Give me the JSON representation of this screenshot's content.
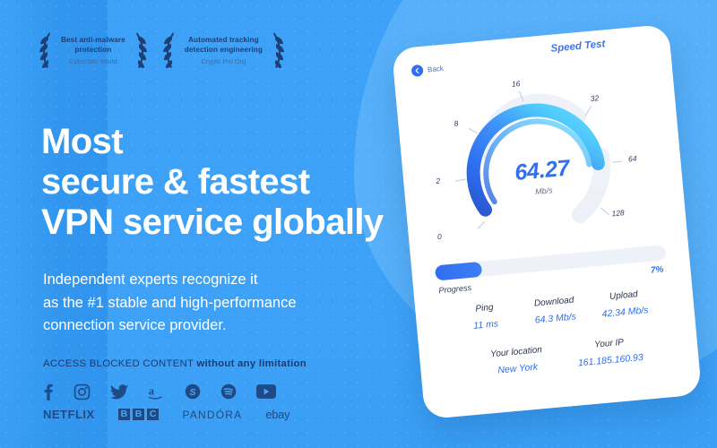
{
  "theme": {
    "bg": "#3da2f7",
    "accent": "#2f6ff0",
    "dark_text": "#1a3c72",
    "card_bg": "#ffffff"
  },
  "badges": [
    {
      "title_line1": "Best anti-malware",
      "title_line2": "protection",
      "subtitle": "CyberSec World"
    },
    {
      "title_line1": "Automated tracking",
      "title_line2": "detection engineering",
      "subtitle": "Crypto Pro Org"
    }
  ],
  "headline": {
    "line1": "Most",
    "line2": "secure & fastest",
    "line3": "VPN service globally"
  },
  "subhead": {
    "line1": "Independent experts recognize it",
    "line2": "as the #1 stable and high-performance",
    "line3": "connection service provider."
  },
  "access": {
    "normal": "ACCESS BLOCKED CONTENT ",
    "bold": "without any limitation"
  },
  "brands": {
    "icons": [
      {
        "name": "facebook-icon",
        "glyph": "f"
      },
      {
        "name": "instagram-icon",
        "glyph": "instagram"
      },
      {
        "name": "twitter-icon",
        "glyph": "twitter"
      },
      {
        "name": "amazon-icon",
        "glyph": "a"
      },
      {
        "name": "skype-icon",
        "glyph": "S"
      },
      {
        "name": "spotify-icon",
        "glyph": "spotify"
      },
      {
        "name": "youtube-icon",
        "glyph": "youtube"
      }
    ],
    "wordmarks": [
      {
        "name": "netflix-wordmark",
        "text": "NETFLIX"
      },
      {
        "name": "bbc-wordmark",
        "letters": [
          "B",
          "B",
          "C"
        ]
      },
      {
        "name": "pandora-wordmark",
        "text": "PANDÓRA"
      },
      {
        "name": "ebay-wordmark",
        "text": "ebay"
      }
    ]
  },
  "card": {
    "back_label": "Back",
    "title": "Speed Test",
    "gauge": {
      "value": "64.27",
      "unit": "Mb/s",
      "ticks": [
        "0",
        "2",
        "8",
        "16",
        "32",
        "64",
        "128"
      ]
    },
    "progress": {
      "label": "Progress",
      "percent_text": "7%",
      "percent": 7
    },
    "stats_row1": [
      {
        "label": "Ping",
        "value": "11 ms"
      },
      {
        "label": "Download",
        "value": "64.3 Mb/s"
      },
      {
        "label": "Upload",
        "value": "42.34 Mb/s"
      }
    ],
    "stats_row2": [
      {
        "label": "Your location",
        "value": "New York"
      },
      {
        "label": "Your IP",
        "value": "161.185.160.93"
      }
    ]
  }
}
